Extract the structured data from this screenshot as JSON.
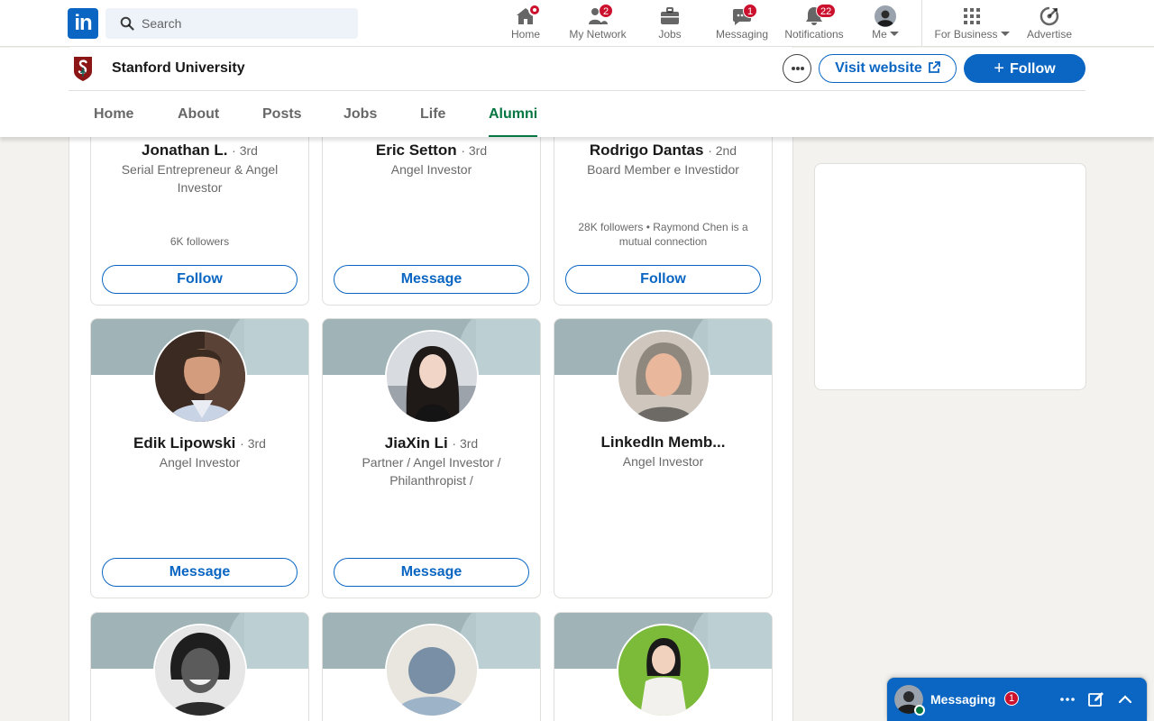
{
  "nav": {
    "search_placeholder": "Search",
    "items": [
      {
        "label": "Home",
        "icon": "home-icon",
        "notification": "dot"
      },
      {
        "label": "My Network",
        "icon": "people-icon",
        "badge": "2"
      },
      {
        "label": "Jobs",
        "icon": "briefcase-icon"
      },
      {
        "label": "Messaging",
        "icon": "chat-icon",
        "badge": "1"
      },
      {
        "label": "Notifications",
        "icon": "bell-icon",
        "badge": "22"
      },
      {
        "label": "Me",
        "icon": "avatar"
      },
      {
        "label": "For Business",
        "icon": "grid-icon"
      },
      {
        "label": "Advertise",
        "icon": "compass-icon"
      }
    ]
  },
  "org": {
    "name": "Stanford University",
    "visit_label": "Visit website",
    "follow_label": "Follow",
    "tabs": [
      "Home",
      "About",
      "Posts",
      "Jobs",
      "Life",
      "Alumni"
    ],
    "active_tab": "Alumni"
  },
  "people": [
    {
      "name": "Jonathan L.",
      "degree": "· 3rd",
      "headline": "Serial Entrepreneur & Angel Investor",
      "meta": "6K followers",
      "action": "Follow"
    },
    {
      "name": "Eric Setton",
      "degree": "· 3rd",
      "headline": "Angel Investor",
      "meta": "",
      "action": "Message"
    },
    {
      "name": "Rodrigo Dantas",
      "degree": "· 2nd",
      "headline": "Board Member e Investidor",
      "meta": "28K followers • Raymond Chen is a mutual connection",
      "action": "Follow"
    },
    {
      "name": "Edik Lipowski",
      "degree": "· 3rd",
      "headline": "Angel Investor",
      "meta": "",
      "action": "Message"
    },
    {
      "name": "JiaXin Li",
      "degree": "· 3rd",
      "headline": "Partner / Angel Investor / Philanthropist /",
      "meta": "",
      "action": "Message"
    },
    {
      "name": "LinkedIn Memb...",
      "degree": "",
      "headline": "Angel Investor",
      "meta": "",
      "action": ""
    }
  ],
  "messaging": {
    "title": "Messaging",
    "badge": "1"
  },
  "colors": {
    "brand": "#0a66c2",
    "active_tab": "#057642",
    "badge": "#cb112d",
    "cardinal": "#8c1515"
  }
}
